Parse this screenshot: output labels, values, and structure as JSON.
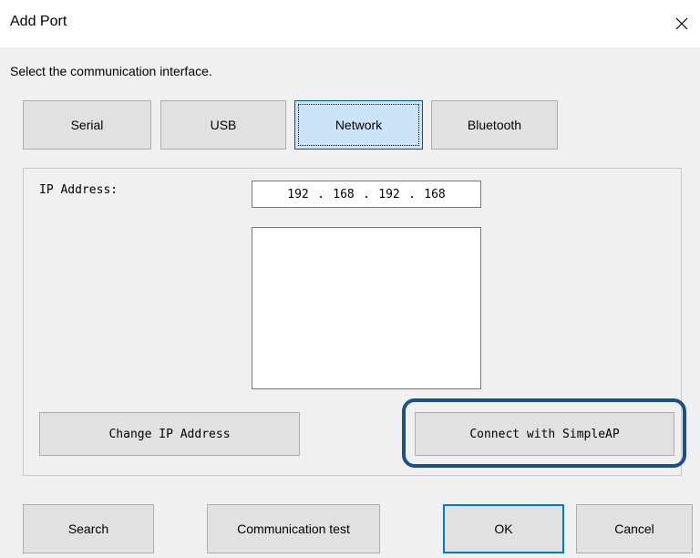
{
  "window": {
    "title": "Add Port",
    "close_symbol": "✕"
  },
  "instruction": "Select the communication interface.",
  "interface_tabs": [
    {
      "label": "Serial",
      "selected": false
    },
    {
      "label": "USB",
      "selected": false
    },
    {
      "label": "Network",
      "selected": true
    },
    {
      "label": "Bluetooth",
      "selected": false
    }
  ],
  "network": {
    "ip_label": "IP Address:",
    "ip_octets": [
      "192",
      "168",
      "192",
      "168"
    ],
    "change_ip_label": "Change IP Address",
    "simpleap_label": "Connect with SimpleAP"
  },
  "footer": {
    "search_label": "Search",
    "comm_test_label": "Communication test",
    "ok_label": "OK",
    "cancel_label": "Cancel"
  },
  "colors": {
    "dialog_bg": "#f0f0f0",
    "button_bg": "#e1e1e1",
    "selected_tab_bg": "#cce4f7",
    "selected_tab_border": "#005499",
    "default_button_border": "#0078d7",
    "highlight_ring": "#1d4f87"
  }
}
